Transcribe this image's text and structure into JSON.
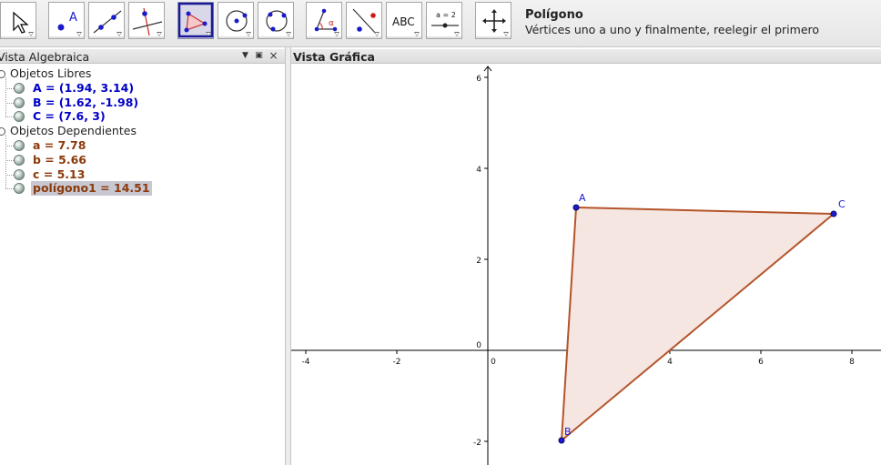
{
  "toolbar": {
    "tools": [
      {
        "name": "move-tool",
        "icon": "arrow-cursor-icon",
        "selected": false
      },
      {
        "name": "new-point-tool",
        "icon": "point-a-icon",
        "selected": false
      },
      {
        "name": "line-tool",
        "icon": "line-through-points-icon",
        "selected": false
      },
      {
        "name": "perpendicular-line-tool",
        "icon": "perpendicular-line-icon",
        "selected": false
      },
      {
        "name": "polygon-tool",
        "icon": "polygon-icon",
        "selected": true
      },
      {
        "name": "circle-tool",
        "icon": "circle-center-point-icon",
        "selected": false
      },
      {
        "name": "circle-three-points-tool",
        "icon": "circle-three-points-icon",
        "selected": false
      },
      {
        "name": "angle-tool",
        "icon": "angle-alpha-icon",
        "selected": false
      },
      {
        "name": "reflect-tool",
        "icon": "reflect-about-line-icon",
        "selected": false
      },
      {
        "name": "text-tool",
        "icon": "abc-text-icon",
        "selected": false,
        "label": "ABC"
      },
      {
        "name": "slider-tool",
        "icon": "slider-icon",
        "selected": false,
        "label": "a = 2"
      },
      {
        "name": "move-view-tool",
        "icon": "move-graphics-view-icon",
        "selected": false
      }
    ],
    "help": {
      "tool_name": "Polígono",
      "description": "Vértices uno a uno y finalmente, reelegir el primero"
    }
  },
  "algebra_view": {
    "title": "Vista Algebraica",
    "folders": [
      {
        "label": "Objetos Libres",
        "items": [
          {
            "text": "A = (1.94, 3.14)",
            "kind": "free",
            "selected": false
          },
          {
            "text": "B = (1.62, -1.98)",
            "kind": "free",
            "selected": false
          },
          {
            "text": "C = (7.6, 3)",
            "kind": "free",
            "selected": false
          }
        ]
      },
      {
        "label": "Objetos Dependientes",
        "items": [
          {
            "text": "a = 7.78",
            "kind": "dep",
            "selected": false
          },
          {
            "text": "b = 5.66",
            "kind": "dep",
            "selected": false
          },
          {
            "text": "c = 5.13",
            "kind": "dep",
            "selected": false
          },
          {
            "text": "polígono1 = 14.51",
            "kind": "dep",
            "selected": true
          }
        ]
      }
    ]
  },
  "graphics_view": {
    "title": "Vista Gráfica",
    "x_ticks": [
      -4,
      -2,
      0,
      2,
      4,
      6,
      8
    ],
    "y_ticks": [
      -2,
      0,
      2,
      4,
      6
    ],
    "points": [
      {
        "label": "A",
        "x": 1.94,
        "y": 3.14
      },
      {
        "label": "B",
        "x": 1.62,
        "y": -1.98
      },
      {
        "label": "C",
        "x": 7.6,
        "y": 3
      }
    ],
    "polygon": [
      "A",
      "B",
      "C"
    ],
    "colors": {
      "point": "#1a1acc",
      "polygon_stroke": "#b5542a",
      "polygon_fill": "#f5e6e1",
      "axis": "#000000",
      "free_object_text": "#0000c8",
      "dependent_object_text": "#8b3a0b"
    }
  }
}
